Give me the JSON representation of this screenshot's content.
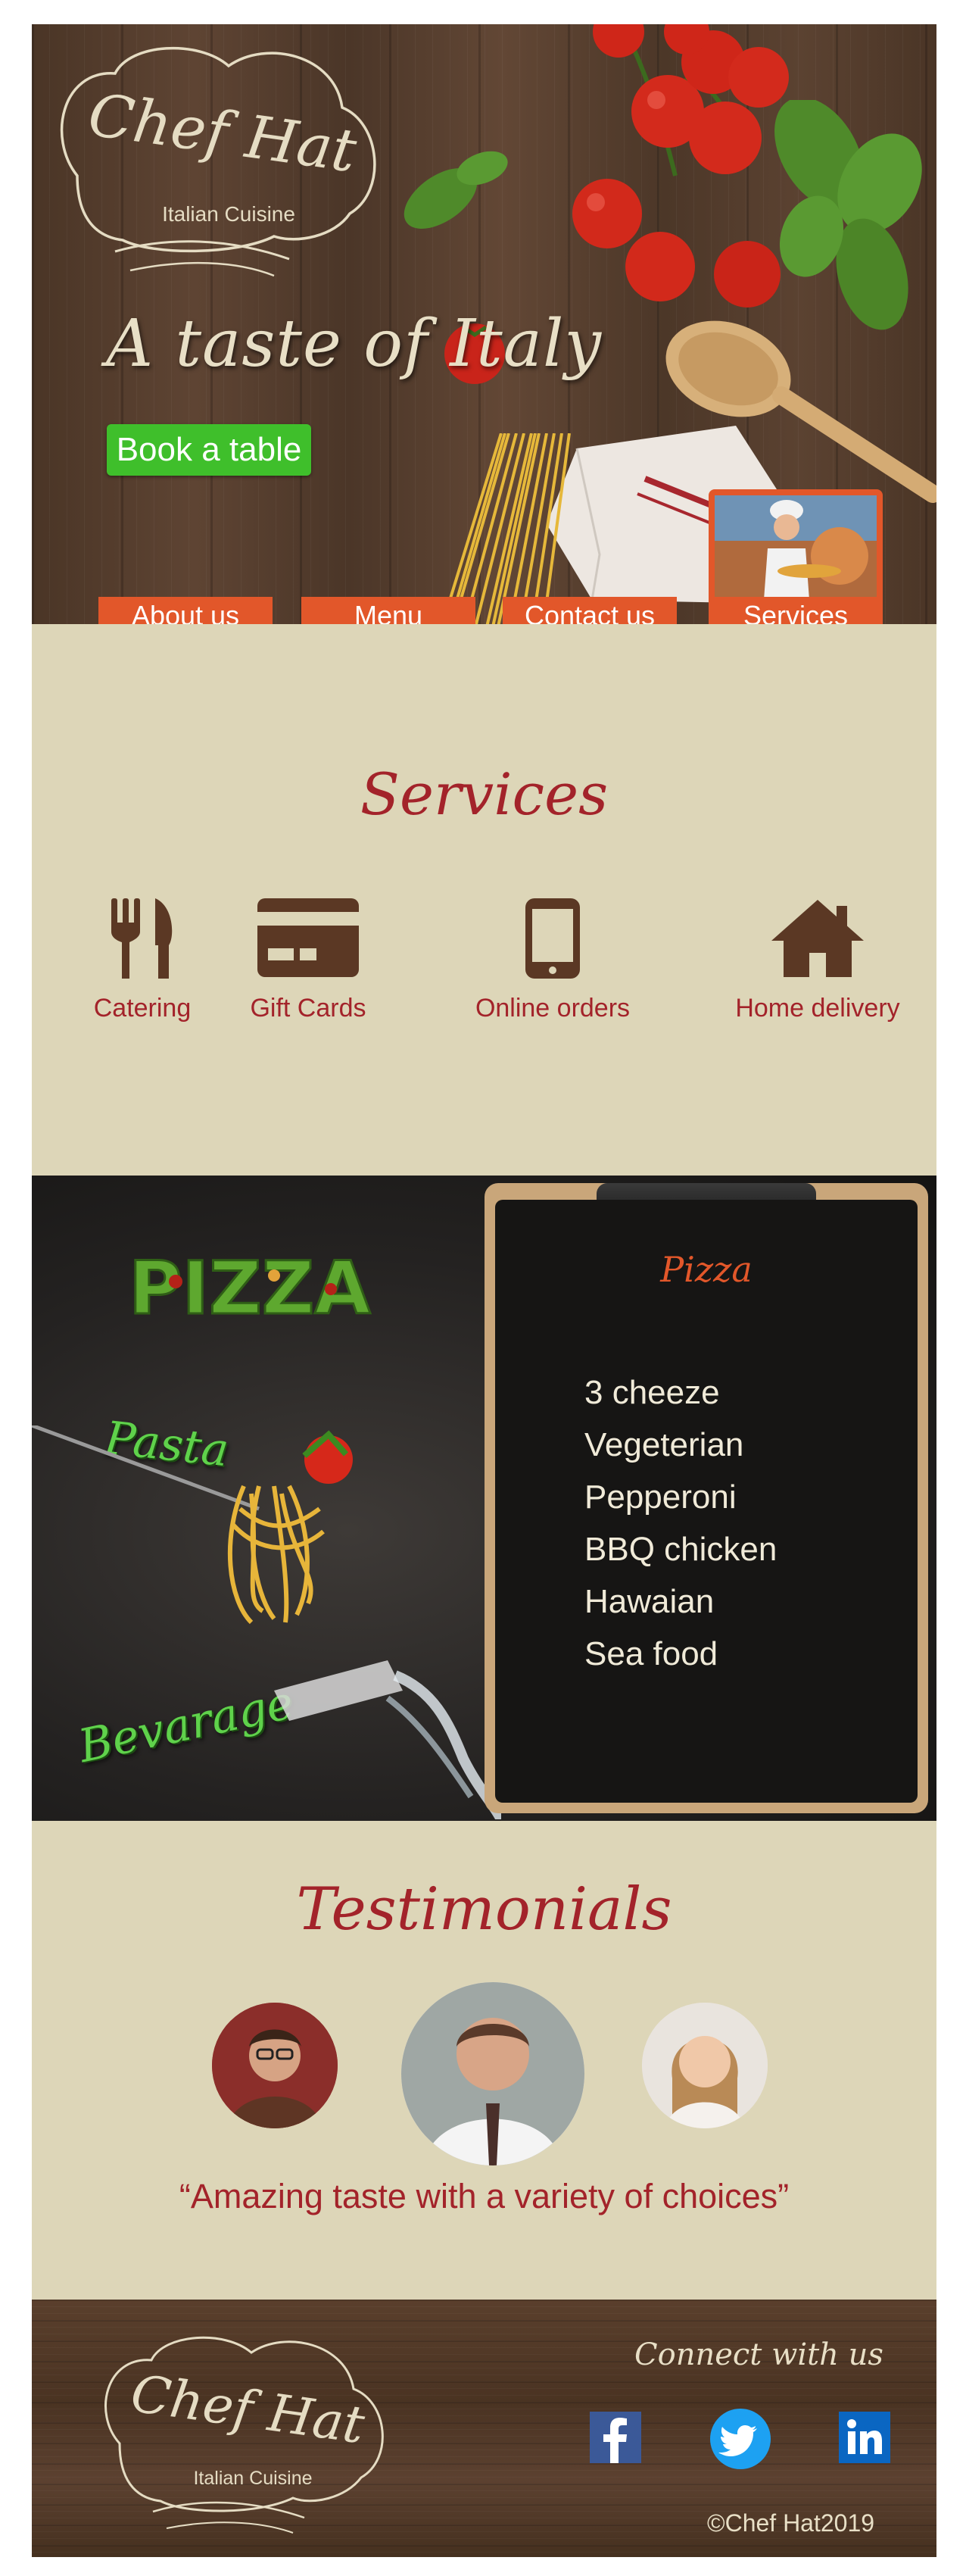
{
  "brand": {
    "name": "Chef Hat",
    "subtitle": "Italian Cuisine"
  },
  "hero": {
    "tagline": "A taste of Italy",
    "book_label": "Book a table"
  },
  "nav": {
    "items": [
      {
        "label": "About us"
      },
      {
        "label": "Menu"
      },
      {
        "label": "Contact us"
      },
      {
        "label": "Services"
      }
    ]
  },
  "services": {
    "title": "Services",
    "items": [
      {
        "label": "Catering",
        "icon": "fork-knife-icon"
      },
      {
        "label": "Gift Cards",
        "icon": "gift-card-icon"
      },
      {
        "label": "Online orders",
        "icon": "mobile-phone-icon"
      },
      {
        "label": "Home delivery",
        "icon": "house-icon"
      }
    ]
  },
  "menu": {
    "categories": {
      "pizza": "PIZZA",
      "pasta": "Pasta",
      "beverage": "Bevarage"
    },
    "board": {
      "title": "Pizza",
      "items": [
        "3 cheeze",
        "Vegeterian",
        "Pepperoni",
        "BBQ chicken",
        "Hawaian",
        "Sea food"
      ]
    }
  },
  "testimonials": {
    "title": "Testimonials",
    "quote": "“Amazing taste with a variety of choices”"
  },
  "footer": {
    "connect": "Connect with us",
    "social": [
      {
        "name": "facebook-icon",
        "glyph": "f",
        "color": "#3b5998"
      },
      {
        "name": "twitter-icon",
        "color": "#1da1f2"
      },
      {
        "name": "linkedin-icon",
        "glyph": "in",
        "color": "#0a66c2"
      }
    ],
    "copyright": "©Chef Hat2019"
  },
  "colors": {
    "accent": "#e2572a",
    "cta": "#3fbf2b",
    "title_red": "#a3232a",
    "beige": "#ddd6b8"
  }
}
